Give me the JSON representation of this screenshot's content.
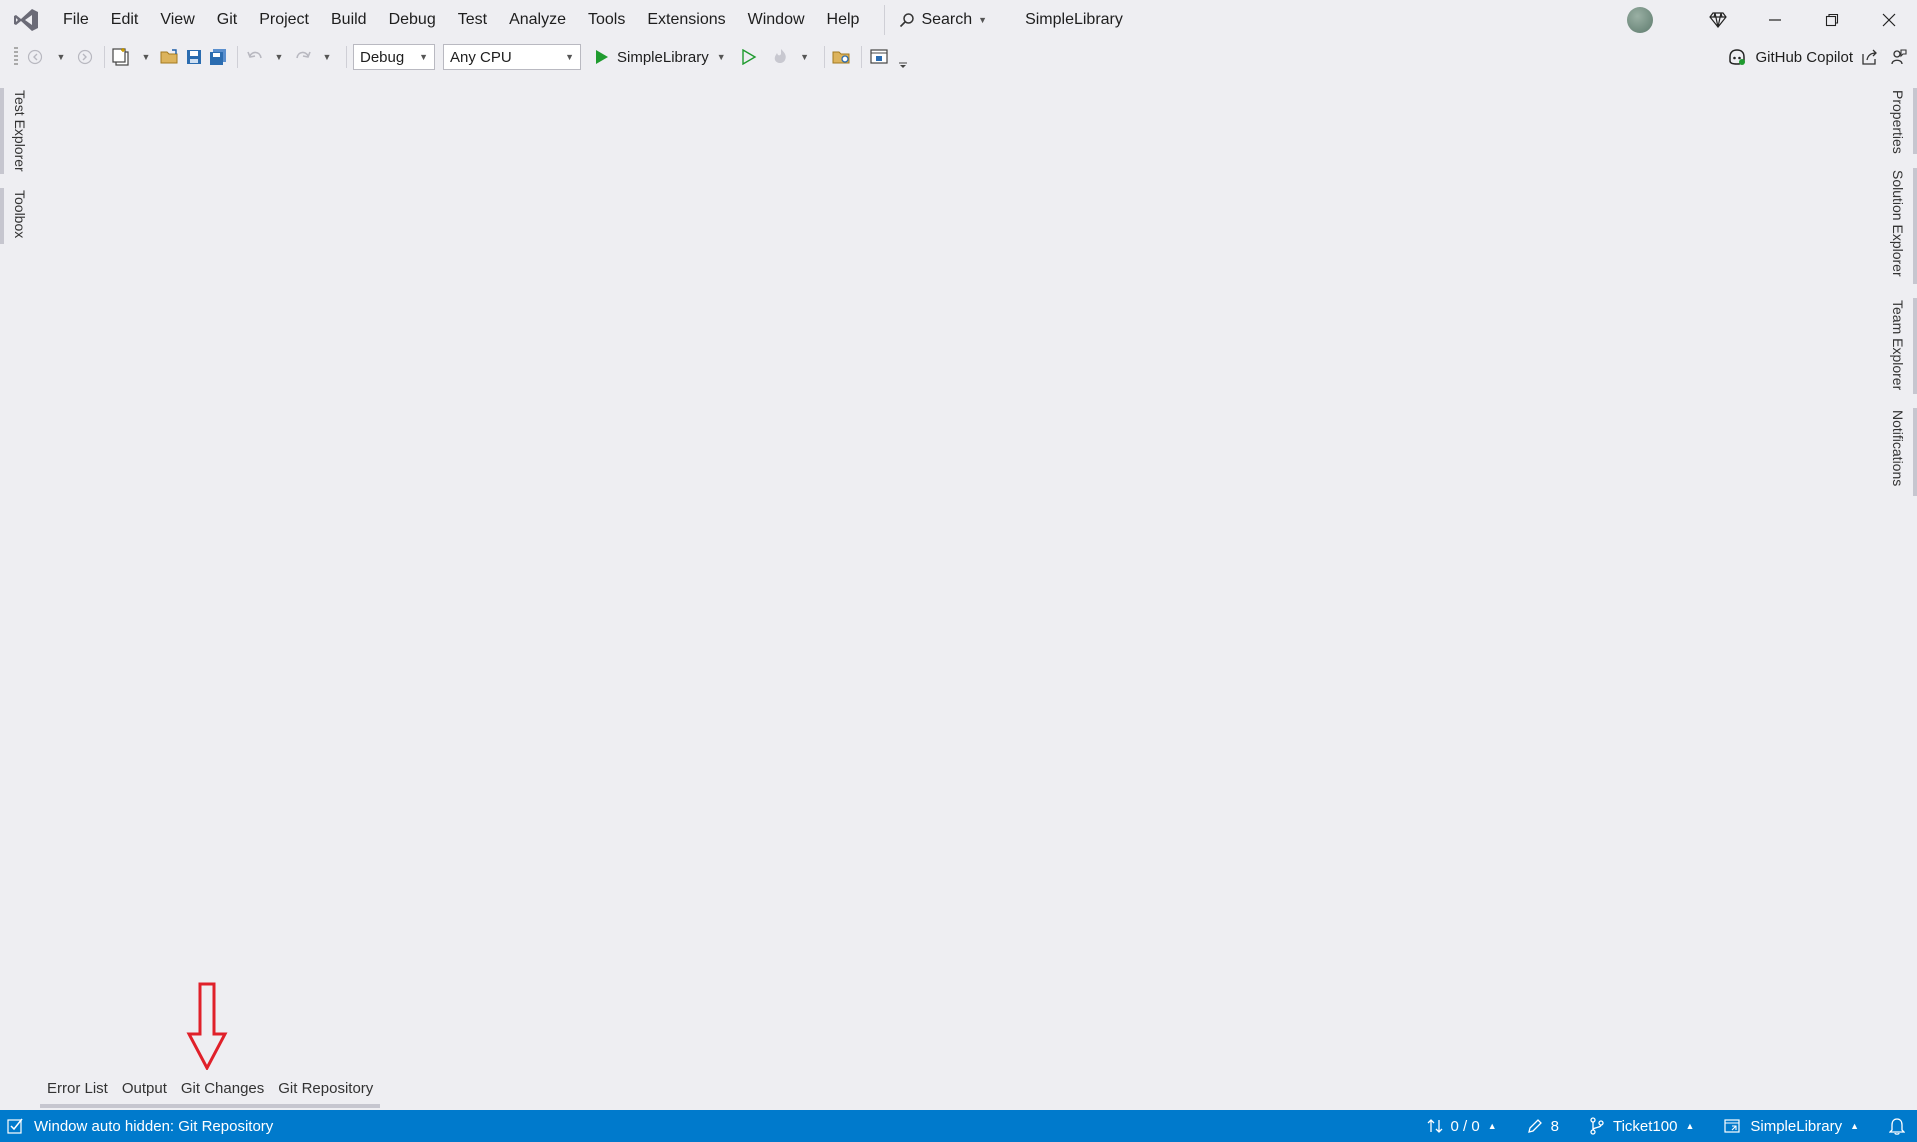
{
  "menu": [
    "File",
    "Edit",
    "View",
    "Git",
    "Project",
    "Build",
    "Debug",
    "Test",
    "Analyze",
    "Tools",
    "Extensions",
    "Window",
    "Help"
  ],
  "search": {
    "label": "Search"
  },
  "solution_title": "SimpleLibrary",
  "toolbar": {
    "config_value": "Debug",
    "platform_value": "Any CPU",
    "run_target": "SimpleLibrary"
  },
  "copilot_label": "GitHub Copilot",
  "left_tabs": [
    "Test Explorer",
    "Toolbox"
  ],
  "right_tabs": [
    "Properties",
    "Solution Explorer",
    "Team Explorer",
    "Notifications"
  ],
  "bottom_tabs": [
    "Error List",
    "Output",
    "Git Changes",
    "Git Repository"
  ],
  "status": {
    "message": "Window auto hidden: Git Repository",
    "sync": "0 / 0",
    "changes": "8",
    "branch": "Ticket100",
    "repo": "SimpleLibrary"
  },
  "colors": {
    "statusbar": "#007acc",
    "annotation_arrow": "#e0202a",
    "run_green": "#1f9b2f"
  }
}
